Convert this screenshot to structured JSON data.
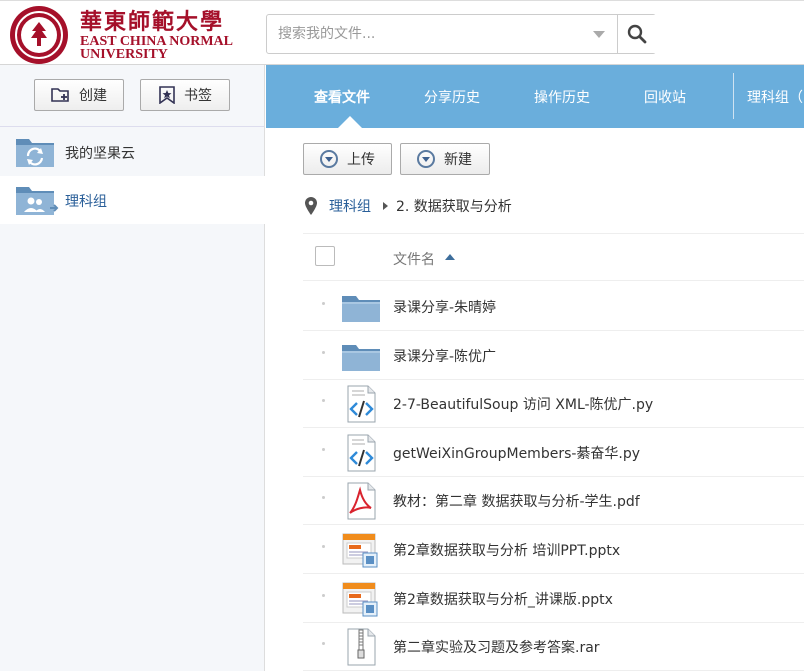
{
  "header": {
    "logo_cn": "華東師範大學",
    "logo_en_line1": "EAST CHINA NORMAL",
    "logo_en_line2": "UNIVERSITY",
    "search_placeholder": "搜索我的文件..."
  },
  "sidebar": {
    "create_label": "创建",
    "bookmark_label": "书签",
    "items": [
      {
        "label": "我的坚果云",
        "icon": "sync-folder-icon"
      },
      {
        "label": "理科组",
        "icon": "shared-group-folder-icon"
      }
    ]
  },
  "nav": {
    "tabs": [
      "查看文件",
      "分享历史",
      "操作历史",
      "回收站"
    ],
    "group_label": "理科组（"
  },
  "toolbar": {
    "upload_label": "上传",
    "new_label": "新建"
  },
  "breadcrumb": {
    "root": "理科组",
    "current": "2. 数据获取与分析"
  },
  "list": {
    "header_name": "文件名",
    "files": [
      {
        "name": "录课分享-朱晴婷",
        "type": "folder"
      },
      {
        "name": "录课分享-陈优广",
        "type": "folder"
      },
      {
        "name": "2-7-BeautifulSoup 访问 XML-陈优广.py",
        "type": "code"
      },
      {
        "name": "getWeiXinGroupMembers-綦奋华.py",
        "type": "code"
      },
      {
        "name": "教材：第二章 数据获取与分析-学生.pdf",
        "type": "pdf"
      },
      {
        "name": "第2章数据获取与分析 培训PPT.pptx",
        "type": "pptx"
      },
      {
        "name": "第2章数据获取与分析_讲课版.pptx",
        "type": "pptx"
      },
      {
        "name": "第二章实验及习题及参考答案.rar",
        "type": "rar"
      }
    ]
  },
  "colors": {
    "brand_red": "#a5102a",
    "nav_blue": "#6aaedc",
    "link_blue": "#2a5f99"
  }
}
